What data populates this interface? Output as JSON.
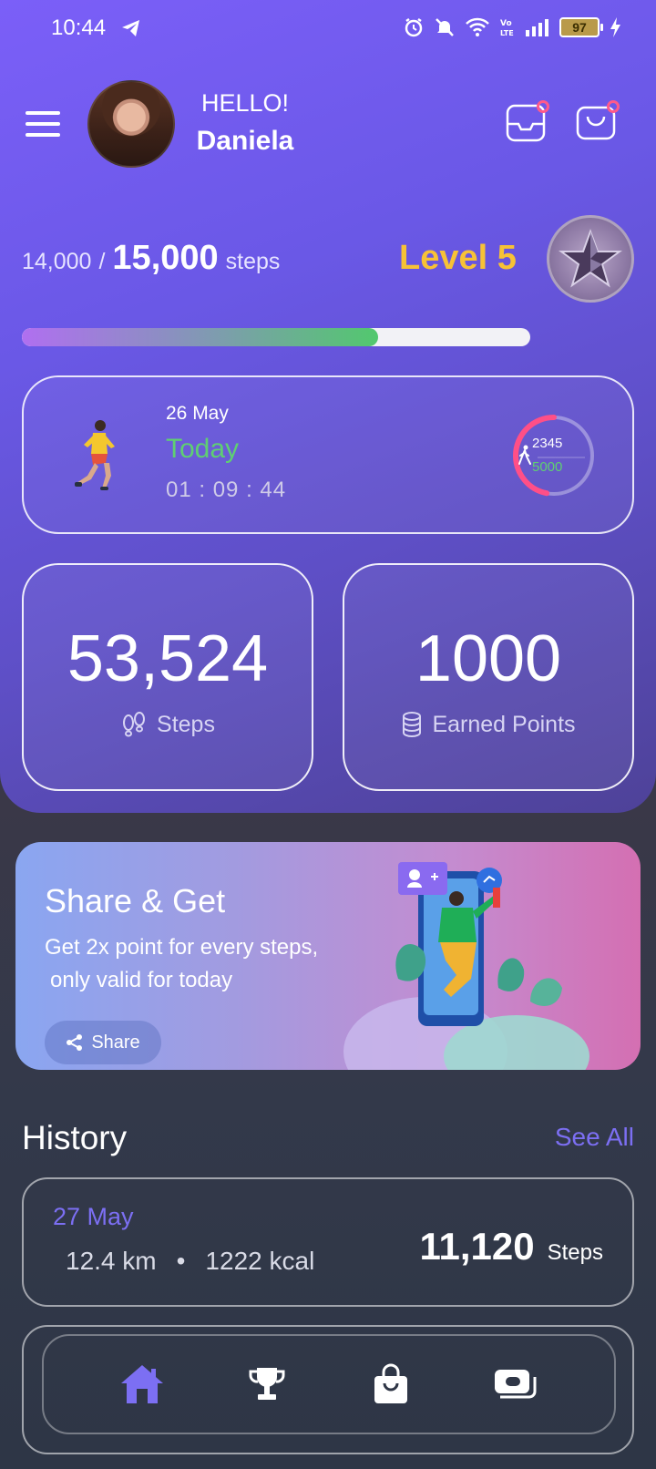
{
  "status_bar": {
    "time": "10:44",
    "battery": "97"
  },
  "header": {
    "greeting": "HELLO!",
    "username": "Daniela"
  },
  "progress": {
    "current_steps": "14,000",
    "separator": "/",
    "goal_steps": "15,000",
    "unit": "steps",
    "level": "Level 5",
    "fill_fraction": 0.7
  },
  "today": {
    "date": "26 May",
    "label": "Today",
    "duration": "01 : 09 : 44",
    "ring_current": "2345",
    "ring_goal": "5000",
    "ring_fraction": 0.469
  },
  "stats": [
    {
      "value": "53,524",
      "label": "Steps"
    },
    {
      "value": "1000",
      "label": "Earned Points"
    }
  ],
  "banner": {
    "title": "Share & Get",
    "desc_line1": "Get 2x point for every steps,",
    "desc_line2": "only valid for today",
    "button": "Share"
  },
  "history": {
    "title": "History",
    "see_all": "See All",
    "items": [
      {
        "date": "27 May",
        "distance": "12.4 km",
        "bullet": "•",
        "calories": "1222 kcal",
        "steps": "11,120",
        "steps_unit": "Steps"
      }
    ]
  },
  "nav": {
    "items": [
      {
        "icon": "home-icon",
        "active": true
      },
      {
        "icon": "trophy-icon",
        "active": false
      },
      {
        "icon": "shopping-bag-icon",
        "active": false
      },
      {
        "icon": "wallet-icon",
        "active": false
      }
    ]
  },
  "colors": {
    "accent": "#7c6ff3",
    "level": "#f7c236",
    "green": "#5fcf72",
    "ring_pink": "#ff4f87"
  }
}
